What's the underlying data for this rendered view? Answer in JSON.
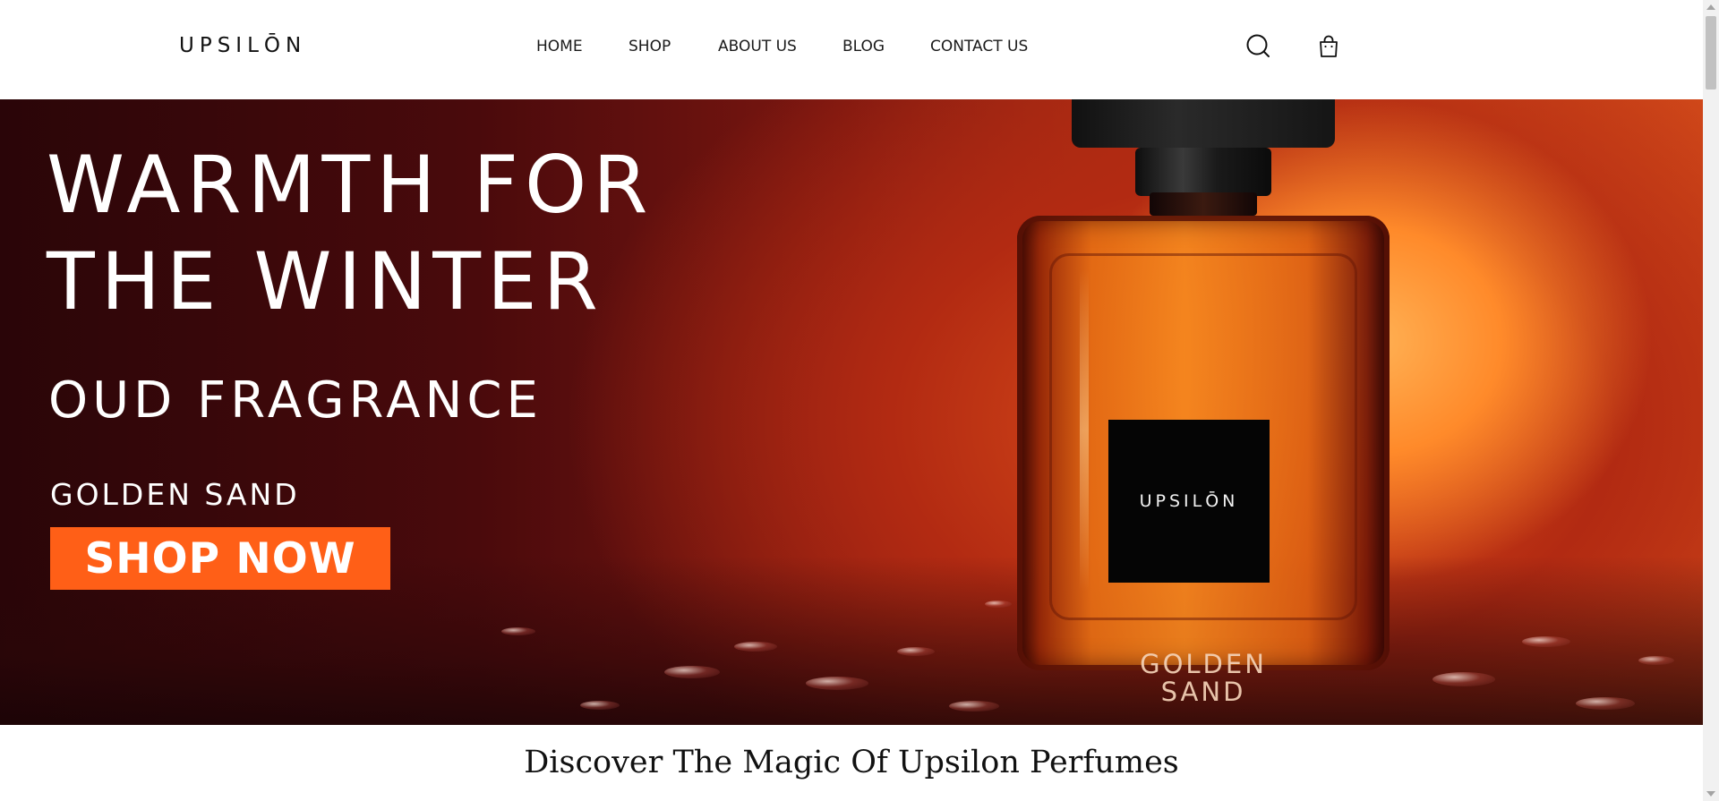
{
  "header": {
    "logo": "UPSILŌN",
    "nav": [
      {
        "label": "HOME"
      },
      {
        "label": "SHOP"
      },
      {
        "label": "ABOUT US"
      },
      {
        "label": "BLOG"
      },
      {
        "label": "CONTACT US"
      }
    ],
    "icons": [
      "search-icon",
      "shopping-bag-icon"
    ]
  },
  "hero": {
    "title_line1": "WARMTH FOR",
    "title_line2": "THE WINTER",
    "subtitle": "OUD FRAGRANCE",
    "product": "GOLDEN SAND",
    "cta": "SHOP NOW",
    "bottle_label": "UPSILŌN",
    "bottle_engraving_line1": "GOLDEN",
    "bottle_engraving_line2": "SAND",
    "accent_color": "#ff5f17"
  },
  "main": {
    "section_title": "Discover The Magic Of Upsilon Perfumes"
  }
}
